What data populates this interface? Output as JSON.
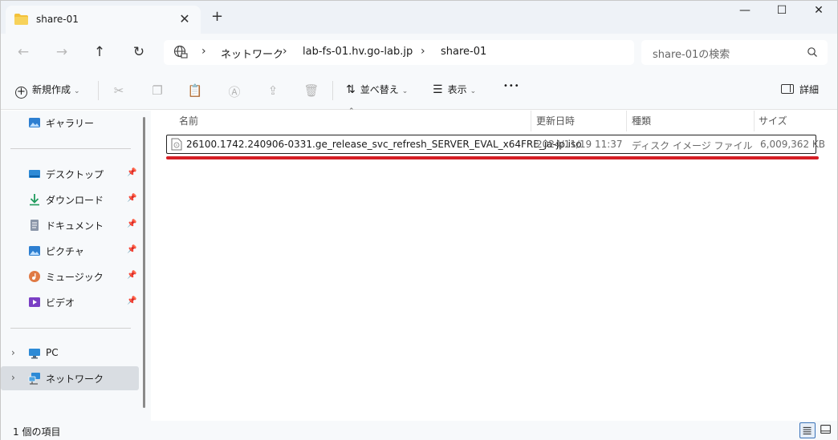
{
  "colors": {
    "accent_red": "#d61f26",
    "selection": "#d9dde2",
    "folder_yellow": "#f3c13a"
  },
  "tab": {
    "title": "share-01",
    "close_glyph": "✕",
    "new_tab_glyph": "+",
    "icon": "folder-icon"
  },
  "window_controls": {
    "minimize": "—",
    "maximize": "☐",
    "close": "✕"
  },
  "nav": {
    "back": "←",
    "forward": "→",
    "up": "↑",
    "refresh": "↻"
  },
  "address": {
    "separator": "›",
    "segments": [
      "ネットワーク",
      "lab-fs-01.hv.go-lab.jp",
      "share-01"
    ]
  },
  "search": {
    "placeholder": "share-01の検索"
  },
  "command_bar": {
    "new_label": "新規作成",
    "sort_label": "並べ替え",
    "view_label": "表示",
    "more_glyph": "•••",
    "details_label": "詳細"
  },
  "sidebar": {
    "gallery": "ギャラリー",
    "pinned": [
      {
        "label": "デスクトップ",
        "icon": "desktop-icon"
      },
      {
        "label": "ダウンロード",
        "icon": "download-icon"
      },
      {
        "label": "ドキュメント",
        "icon": "documents-icon"
      },
      {
        "label": "ピクチャ",
        "icon": "pictures-icon"
      },
      {
        "label": "ミュージック",
        "icon": "music-icon"
      },
      {
        "label": "ビデオ",
        "icon": "video-icon"
      }
    ],
    "pc": "PC",
    "network": "ネットワーク",
    "expander": "›"
  },
  "columns": {
    "name": "名前",
    "date": "更新日時",
    "type": "種類",
    "size": "サイズ"
  },
  "files": [
    {
      "name": "26100.1742.240906-0331.ge_release_svc_refresh_SERVER_EVAL_x64FRE_ja-jp.iso",
      "date": "2024/11/19 11:37",
      "type": "ディスク イメージ ファイル",
      "size": "6,009,362 KB"
    }
  ],
  "status": {
    "item_count": "1 個の項目"
  }
}
